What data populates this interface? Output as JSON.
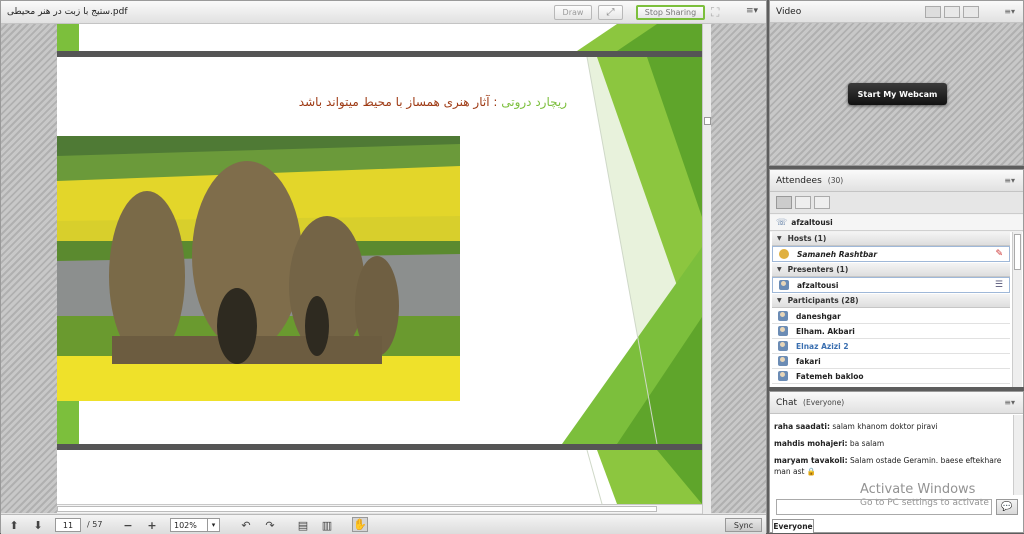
{
  "share": {
    "filename": "ستیج با زبت در هنر محیطی.pdf",
    "draw_label": "Draw",
    "stop_sharing_label": "Stop Sharing",
    "slide_title_name": "ریچارد دروتی",
    "slide_title_rest": " : آثار هنری  همساز با محیط میتواند باشد",
    "page_current": "11",
    "page_total": "/ 57",
    "zoom": "102%",
    "sync_label": "Sync"
  },
  "video": {
    "title": "Video",
    "webcam_button": "Start My Webcam"
  },
  "attendees": {
    "title": "Attendees",
    "count": "(30)",
    "me": "afzaltousi",
    "hosts_header": "Hosts (1)",
    "host_name": "Samaneh Rashtbar",
    "presenters_header": "Presenters (1)",
    "presenter_name": "afzaltousi",
    "participants_header": "Participants (28)",
    "participants": [
      "daneshgar",
      "Elham. Akbari",
      "Elnaz Azizi 2",
      "fakari",
      "Fatemeh bakloo"
    ],
    "highlight_color": "#3a6fb0"
  },
  "chat": {
    "title": "Chat",
    "scope": "(Everyone)",
    "messages": [
      {
        "user": "raha saadati:",
        "text": "salam khanom doktor piravi"
      },
      {
        "user": "mahdis mohajeri:",
        "text": "ba salam"
      },
      {
        "user": "maryam tavakoli:",
        "text": "Salam ostade Geramin. baese eftekhare man ast"
      }
    ],
    "audience": "Everyone",
    "watermark_title": "Activate Windows",
    "watermark_sub": "Go to PC settings to activate"
  },
  "colors": {
    "green_accent": "#7cbf3c",
    "slide_title_green": "#7cbf3c",
    "slide_title_red": "#9e3a14"
  }
}
